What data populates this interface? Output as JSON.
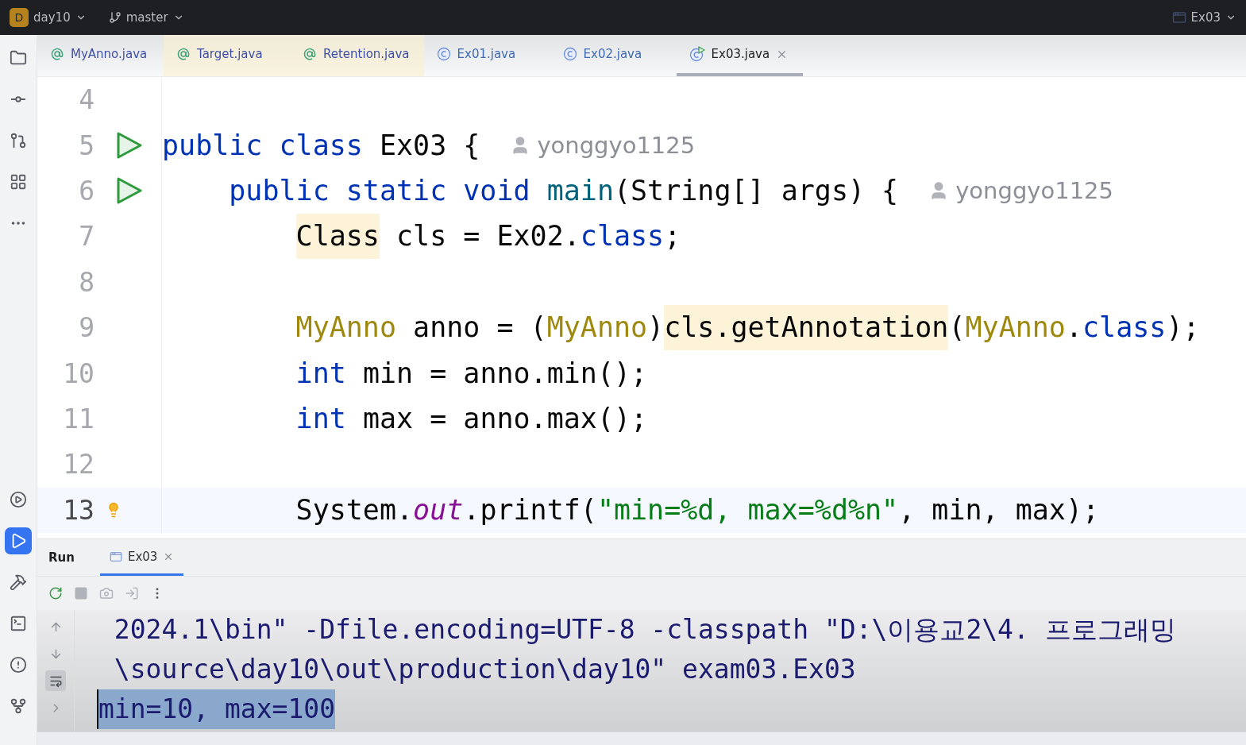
{
  "title_bar": {
    "project_badge": "D",
    "project": "day10",
    "branch": "master",
    "run_config": "Ex03"
  },
  "tool_strip_top": [
    {
      "kind": "folder"
    },
    {
      "kind": "commit"
    },
    {
      "kind": "pull"
    },
    {
      "kind": "structure"
    },
    {
      "kind": "more"
    }
  ],
  "tool_strip_bottom": [
    {
      "kind": "services",
      "selected": false
    },
    {
      "kind": "run",
      "selected": true
    },
    {
      "kind": "build",
      "selected": false
    },
    {
      "kind": "terminal",
      "selected": false
    },
    {
      "kind": "problems",
      "selected": false
    },
    {
      "kind": "git",
      "selected": false
    }
  ],
  "tabs": [
    {
      "label": "MyAnno.java",
      "kind": "annotation",
      "selected": false,
      "tinted": false
    },
    {
      "label": "Target.java",
      "kind": "annotation",
      "selected": false,
      "tinted": true
    },
    {
      "label": "Retention.java",
      "kind": "annotation",
      "selected": false,
      "tinted": true
    },
    {
      "label": "Ex01.java",
      "kind": "class",
      "selected": false,
      "tinted": false
    },
    {
      "label": "Ex02.java",
      "kind": "class",
      "selected": false,
      "tinted": false
    },
    {
      "label": "Ex03.java",
      "kind": "runnable",
      "selected": true,
      "tinted": false
    }
  ],
  "code_lines": [
    {
      "number": "4",
      "run_marker": false,
      "bulb": false,
      "current": false
    },
    {
      "number": "5",
      "run_marker": true,
      "bulb": false,
      "current": false,
      "tokens": [
        {
          "kind": "keyword",
          "text": "public class"
        },
        {
          "kind": "plain",
          "text": " Ex03 {"
        }
      ],
      "author": "yonggyo1125"
    },
    {
      "number": "6",
      "run_marker": true,
      "bulb": false,
      "current": false,
      "tokens": [
        {
          "kind": "keyword",
          "text": "    public static void "
        },
        {
          "kind": "method",
          "text": "main"
        },
        {
          "kind": "plain",
          "text": "(String[] args) {"
        }
      ],
      "author": "yonggyo1125"
    },
    {
      "number": "7",
      "run_marker": false,
      "bulb": false,
      "current": false,
      "tokens": [
        {
          "kind": "plain",
          "text": "        Class",
          "highlight": true
        },
        {
          "kind": "plain",
          "text": " cls = Ex02."
        },
        {
          "kind": "keyword",
          "text": "class"
        },
        {
          "kind": "plain",
          "text": ";"
        }
      ]
    },
    {
      "number": "8",
      "run_marker": false,
      "bulb": false,
      "current": false
    },
    {
      "number": "9",
      "run_marker": false,
      "bulb": false,
      "current": false,
      "tokens": [
        {
          "kind": "annotation",
          "text": "        MyAnno"
        },
        {
          "kind": "plain",
          "text": " anno = ("
        },
        {
          "kind": "annotation",
          "text": "MyAnno"
        },
        {
          "kind": "plain",
          "text": ")"
        },
        {
          "kind": "plain",
          "text": "cls.getAnnotation",
          "highlight": true
        },
        {
          "kind": "plain",
          "text": "("
        },
        {
          "kind": "annotation",
          "text": "MyAnno"
        },
        {
          "kind": "plain",
          "text": "."
        },
        {
          "kind": "keyword",
          "text": "class"
        },
        {
          "kind": "plain",
          "text": ");"
        }
      ]
    },
    {
      "number": "10",
      "run_marker": false,
      "bulb": false,
      "current": false,
      "tokens": [
        {
          "kind": "keyword",
          "text": "        int"
        },
        {
          "kind": "plain",
          "text": " min = anno.min();"
        }
      ]
    },
    {
      "number": "11",
      "run_marker": false,
      "bulb": false,
      "current": false,
      "tokens": [
        {
          "kind": "keyword",
          "text": "        int"
        },
        {
          "kind": "plain",
          "text": " max = anno.max();"
        }
      ]
    },
    {
      "number": "12",
      "run_marker": false,
      "bulb": false,
      "current": false
    },
    {
      "number": "13",
      "run_marker": false,
      "bulb": true,
      "current": true,
      "tokens": [
        {
          "kind": "plain",
          "text": "        System."
        },
        {
          "kind": "field",
          "text": "out"
        },
        {
          "kind": "plain",
          "text": ".printf("
        },
        {
          "kind": "string",
          "text": "\"min=%d, max=%d%n\""
        },
        {
          "kind": "plain",
          "text": ", min, max);"
        }
      ]
    }
  ],
  "run_panel": {
    "title": "Run",
    "tabs": [
      {
        "label": "Ex03",
        "selected": true
      }
    ],
    "toolbar": [
      {
        "kind": "rerun",
        "disabled": false
      },
      {
        "kind": "stop",
        "disabled": true
      },
      {
        "kind": "camera",
        "disabled": true
      },
      {
        "kind": "export",
        "disabled": true
      },
      {
        "kind": "more",
        "disabled": false
      }
    ],
    "side": [
      {
        "kind": "up",
        "on": false
      },
      {
        "kind": "down",
        "on": false
      },
      {
        "kind": "wrap",
        "on": true
      },
      {
        "kind": "expand",
        "on": false
      }
    ],
    "console_lines": [
      {
        "text": " 2024.1\\bin\" -Dfile.encoding=UTF-8 -classpath \"D:\\이용교2\\4. 프로그래밍",
        "selected": false
      },
      {
        "text": " \\source\\day10\\out\\production\\day10\" exam03.Ex03",
        "selected": false
      },
      {
        "text": "min=10, max=100",
        "selected": true
      }
    ]
  }
}
